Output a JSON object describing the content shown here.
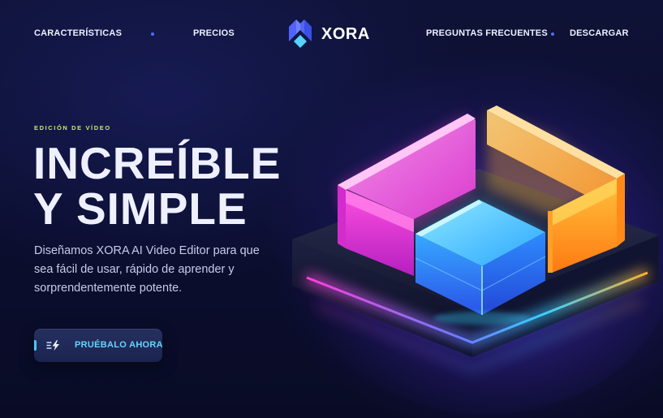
{
  "nav": {
    "left_links": [
      {
        "label": "CARACTERÍSTICAS",
        "icon": "none"
      },
      {
        "label": "PRECIOS",
        "icon": "none"
      }
    ],
    "right_links": [
      {
        "label": "PREGUNTAS FRECUENTES",
        "icon": "none"
      },
      {
        "label": "DESCARGAR",
        "icon": "none"
      }
    ],
    "separator_icon": "dot",
    "logo": {
      "text": "XORA",
      "icon": "xora-logo-icon"
    }
  },
  "hero": {
    "eyebrow": "EDICIÓN DE VÍDEO",
    "headline_line1": "INCREÍBLE",
    "headline_line2": "Y SIMPLE",
    "description": "Diseñamos XORA AI Video Editor para que sea fácil de usar, rápido de aprender y sorprendentemente potente.",
    "cta": {
      "label": "PRUÉBALO AHORA",
      "icon": "lightning-icon"
    },
    "illustration": "glowing-glass-blocks"
  },
  "colors": {
    "background": "#0b0d2a",
    "accent_blue": "#4f6bff",
    "cta_text": "#63d4ff",
    "eyebrow": "#c9e86a",
    "magenta": "#ff3fd8",
    "orange": "#ffb02e",
    "cyan": "#3fb6ff"
  }
}
